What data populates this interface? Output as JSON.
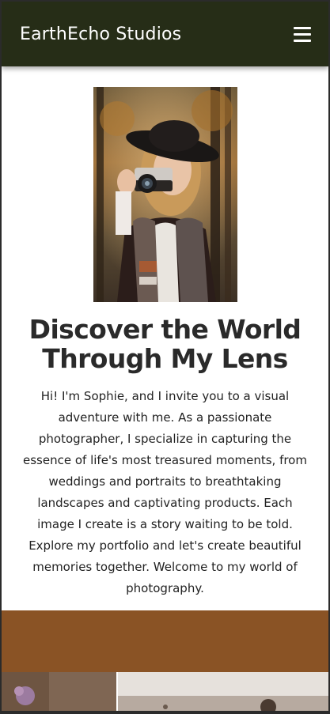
{
  "brand": "EarthEcho Studios",
  "nav": {
    "menu_icon": "hamburger-menu-icon"
  },
  "hero": {
    "image_alt": "Woman holding a camera up to her eye in an autumn forest",
    "title": "Discover the World Through My Lens",
    "intro": "Hi! I'm Sophie, and I invite you to a visual adventure with me. As a passionate photographer, I specialize in capturing the essence of life's most treasured moments, from weddings and portraits to breathtaking landscapes and captivating products. Each image I create is a story waiting to be told. Explore my portfolio and let's create beautiful memories together. Welcome to my world of photography."
  },
  "colors": {
    "navbar": "#262d17",
    "band": "#8a5325",
    "text": "#2a2a2a"
  }
}
